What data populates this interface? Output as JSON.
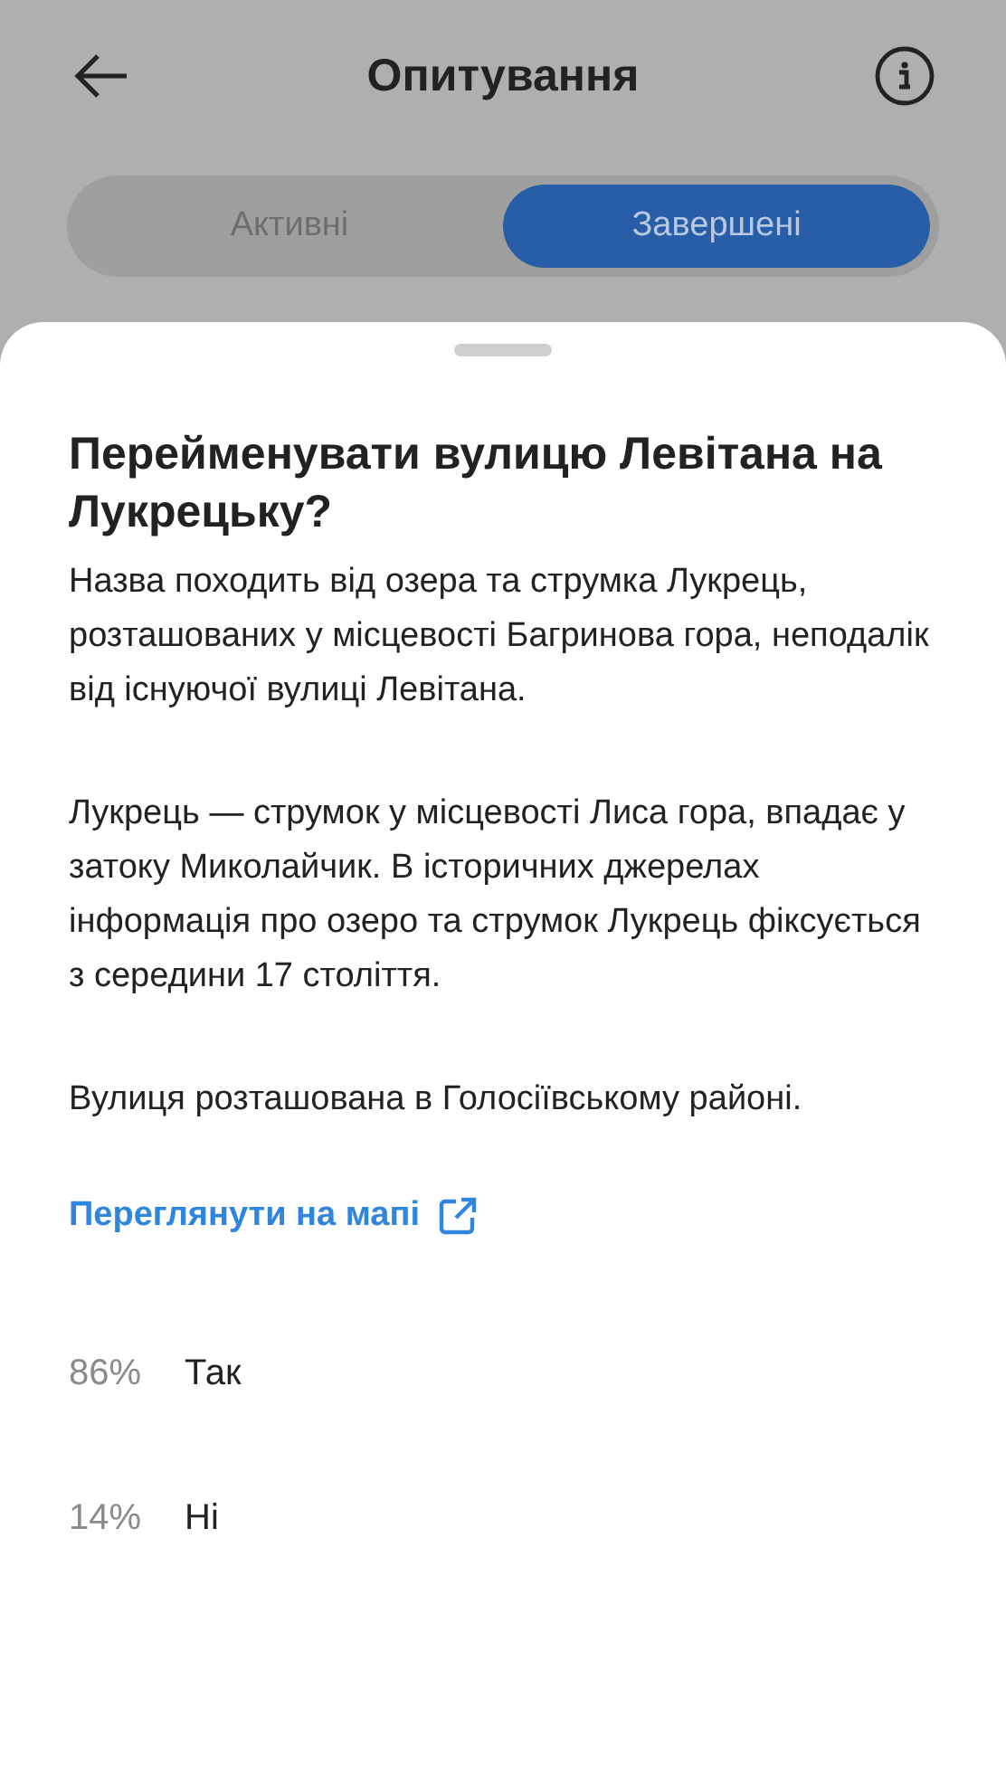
{
  "header": {
    "title": "Опитування"
  },
  "tabs": [
    {
      "label": "Активні",
      "selected": false
    },
    {
      "label": "Завершені",
      "selected": true
    }
  ],
  "poll": {
    "question": "Перейменувати вулицю Левітана на Лукрецьку?",
    "paragraphs": [
      "Назва походить від озера та струмка Лукрець, розташованих у місцевості Багринова гора, неподалік від існуючої вулиці Левітана.",
      "Лукрець — струмок у місцевості Лиса гора, впадає у затоку Миколайчик. В історичних джерелах інформація про озеро та струмок Лукрець фіксується з середини 17 століття.",
      "Вулиця розташована в Голосіївському районі."
    ],
    "map_link": "Переглянути на мапі",
    "results": [
      {
        "percent": "86%",
        "label": "Так"
      },
      {
        "percent": "14%",
        "label": "Ні"
      }
    ]
  }
}
